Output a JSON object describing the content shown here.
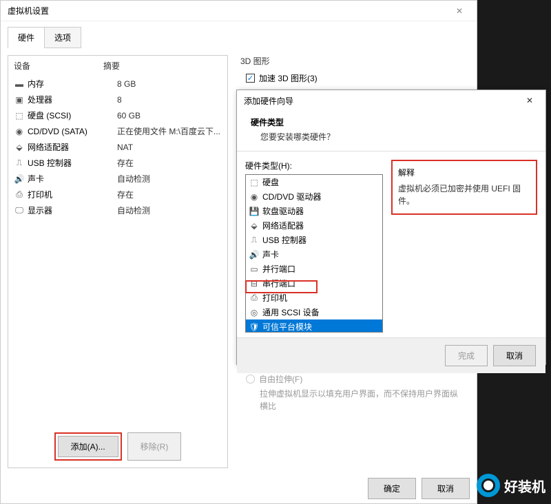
{
  "main_window": {
    "title": "虚拟机设置",
    "tabs": {
      "hardware": "硬件",
      "options": "选项"
    },
    "headers": {
      "device": "设备",
      "summary": "摘要"
    },
    "hardware": [
      {
        "icon": "memory",
        "device": "内存",
        "summary": "8 GB"
      },
      {
        "icon": "cpu",
        "device": "处理器",
        "summary": "8"
      },
      {
        "icon": "disk",
        "device": "硬盘 (SCSI)",
        "summary": "60 GB"
      },
      {
        "icon": "cd",
        "device": "CD/DVD (SATA)",
        "summary": "正在使用文件 M:\\百度云下..."
      },
      {
        "icon": "net",
        "device": "网络适配器",
        "summary": "NAT"
      },
      {
        "icon": "usb",
        "device": "USB 控制器",
        "summary": "存在"
      },
      {
        "icon": "sound",
        "device": "声卡",
        "summary": "自动检测"
      },
      {
        "icon": "printer",
        "device": "打印机",
        "summary": "存在"
      },
      {
        "icon": "display",
        "device": "显示器",
        "summary": "自动检测"
      }
    ],
    "buttons": {
      "add": "添加(A)...",
      "remove": "移除(R)",
      "ok": "确定",
      "cancel": "取消"
    },
    "right": {
      "graphics_title": "3D 图形",
      "accel_3d": "加速 3D 图形(3)",
      "stretch_label": "自由拉伸(F)",
      "stretch_hint": "拉伸虚拟机显示以填充用户界面，而不保持用户界面纵横比"
    }
  },
  "wizard": {
    "title": "添加硬件向导",
    "header_title": "硬件类型",
    "header_sub": "您要安装哪类硬件？",
    "list_label": "硬件类型(H):",
    "explain_label": "解释",
    "explain_text": "虚拟机必须已加密并使用 UEFI 固件。",
    "items": [
      {
        "icon": "disk",
        "label": "硬盘"
      },
      {
        "icon": "cd",
        "label": "CD/DVD 驱动器"
      },
      {
        "icon": "floppy",
        "label": "软盘驱动器"
      },
      {
        "icon": "net",
        "label": "网络适配器"
      },
      {
        "icon": "usb",
        "label": "USB 控制器"
      },
      {
        "icon": "sound",
        "label": "声卡"
      },
      {
        "icon": "parallel",
        "label": "并行端口"
      },
      {
        "icon": "serial",
        "label": "串行端口"
      },
      {
        "icon": "printer",
        "label": "打印机"
      },
      {
        "icon": "scsi",
        "label": "通用 SCSI 设备"
      },
      {
        "icon": "tpm",
        "label": "可信平台模块",
        "selected": true
      }
    ],
    "buttons": {
      "finish": "完成",
      "cancel": "取消"
    }
  },
  "watermark": "好装机"
}
